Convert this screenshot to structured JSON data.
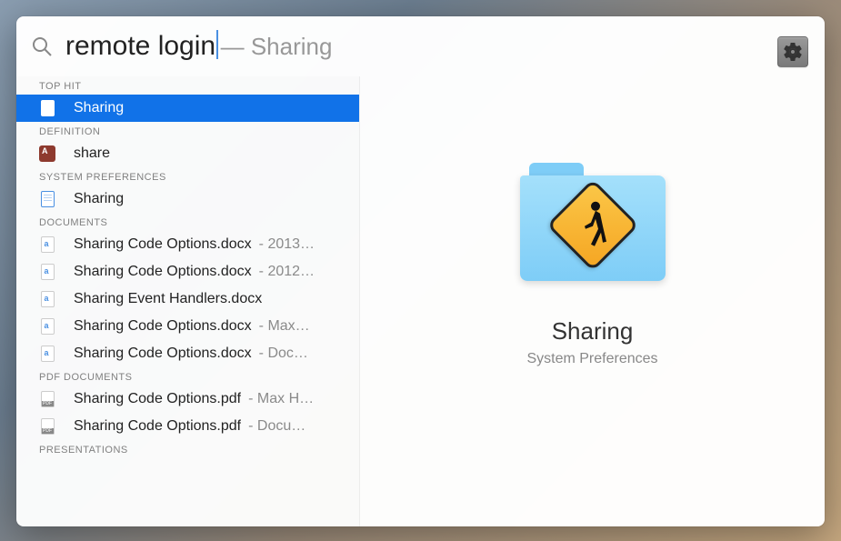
{
  "search": {
    "query": "remote login",
    "completion": " — Sharing"
  },
  "sections": [
    {
      "header": "TOP HIT",
      "items": [
        {
          "title": "Sharing",
          "meta": "",
          "icon": "prefpane",
          "selected": true
        }
      ]
    },
    {
      "header": "DEFINITION",
      "items": [
        {
          "title": "share",
          "meta": "",
          "icon": "dictionary",
          "selected": false
        }
      ]
    },
    {
      "header": "SYSTEM PREFERENCES",
      "items": [
        {
          "title": "Sharing",
          "meta": "",
          "icon": "prefpane",
          "selected": false
        }
      ]
    },
    {
      "header": "DOCUMENTS",
      "items": [
        {
          "title": "Sharing Code Options.docx",
          "meta": "- 2013…",
          "icon": "docx",
          "selected": false
        },
        {
          "title": "Sharing Code Options.docx",
          "meta": "- 2012…",
          "icon": "docx",
          "selected": false
        },
        {
          "title": "Sharing Event Handlers.docx",
          "meta": "",
          "icon": "docx",
          "selected": false
        },
        {
          "title": "Sharing Code Options.docx",
          "meta": "- Max…",
          "icon": "docx",
          "selected": false
        },
        {
          "title": "Sharing Code Options.docx",
          "meta": "- Doc…",
          "icon": "docx",
          "selected": false
        }
      ]
    },
    {
      "header": "PDF DOCUMENTS",
      "items": [
        {
          "title": "Sharing Code Options.pdf",
          "meta": "- Max H…",
          "icon": "pdf",
          "selected": false
        },
        {
          "title": "Sharing Code Options.pdf",
          "meta": "- Docu…",
          "icon": "pdf",
          "selected": false
        }
      ]
    },
    {
      "header": "PRESENTATIONS",
      "items": []
    }
  ],
  "preview": {
    "title": "Sharing",
    "subtitle": "System Preferences"
  }
}
